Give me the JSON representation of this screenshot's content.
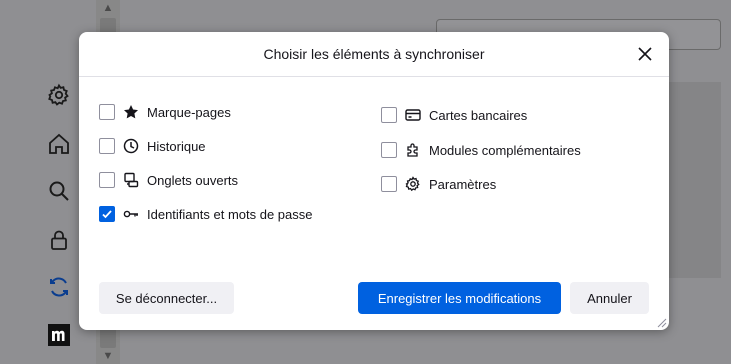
{
  "dialog": {
    "title": "Choisir les éléments à synchroniser",
    "options_left": [
      {
        "label": "Marque-pages",
        "icon": "star-icon",
        "checked": false
      },
      {
        "label": "Historique",
        "icon": "clock-icon",
        "checked": false
      },
      {
        "label": "Onglets ouverts",
        "icon": "synced-tabs-icon",
        "checked": false
      },
      {
        "label": "Identifiants et mots de passe",
        "icon": "key-icon",
        "checked": true
      }
    ],
    "options_right": [
      {
        "label": "Cartes bancaires",
        "icon": "credit-card-icon",
        "checked": false
      },
      {
        "label": "Modules complémentaires",
        "icon": "puzzle-icon",
        "checked": false
      },
      {
        "label": "Paramètres",
        "icon": "gear-icon",
        "checked": false
      }
    ],
    "buttons": {
      "disconnect": "Se déconnecter...",
      "save": "Enregistrer les modifications",
      "cancel": "Annuler"
    }
  },
  "colors": {
    "accent": "#0061e0",
    "overlay": "#8f8f92",
    "dialog_bg": "#ffffff"
  }
}
